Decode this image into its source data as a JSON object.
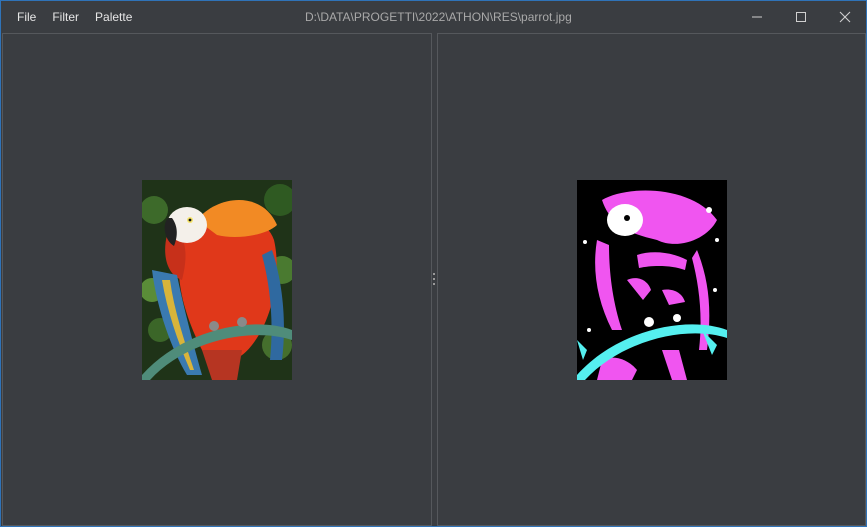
{
  "menu": {
    "file": "File",
    "filter": "Filter",
    "palette": "Palette"
  },
  "window": {
    "title": "D:\\DATA\\PROGETTI\\2022\\ATHON\\RES\\parrot.jpg"
  },
  "icons": {
    "minimize": "minimize-icon",
    "maximize": "maximize-icon",
    "close": "close-icon",
    "splitter": "grip-icon"
  },
  "colors": {
    "background": "#3a3d41",
    "border": "#2f73b8",
    "filtered_magenta": "#f055f0",
    "filtered_cyan": "#55f0f0"
  }
}
